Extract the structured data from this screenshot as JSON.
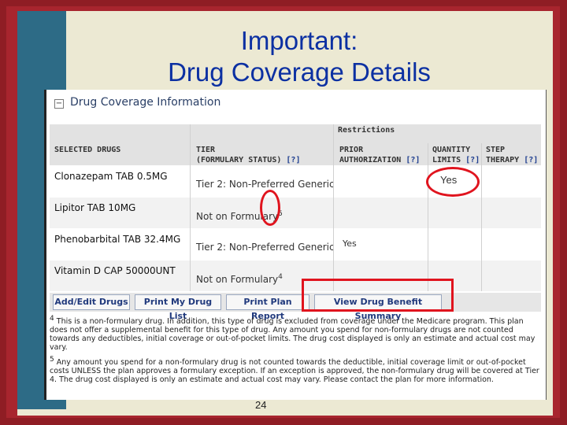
{
  "slide": {
    "title_line1": "Important:",
    "title_line2": "Drug Coverage Details",
    "page_number": "24",
    "callout_yes": "Yes",
    "accent_red": "#e0141e",
    "title_color": "#0c30a2"
  },
  "panel": {
    "collapse_symbol": "−",
    "heading": "Drug Coverage Information",
    "restrictions_label": "Restrictions",
    "columns": {
      "drugs": "SELECTED DRUGS",
      "tier_line1": "TIER",
      "tier_line2": "(FORMULARY STATUS)",
      "prior_line1": "PRIOR",
      "prior_line2": "AUTHORIZATION",
      "qty_line1": "QUANTITY",
      "qty_line2": "LIMITS",
      "step_line1": "STEP",
      "step_line2": "THERAPY",
      "help": "[?]"
    },
    "rows": [
      {
        "drug": "Clonazepam TAB 0.5MG",
        "tier": "Tier 2: Non-Preferred Generic",
        "note": "",
        "prior": ""
      },
      {
        "drug": "Lipitor TAB 10MG",
        "tier": "Not on Formulary",
        "note": "5",
        "prior": ""
      },
      {
        "drug": "Phenobarbital TAB 32.4MG",
        "tier": "Tier 2: Non-Preferred Generic",
        "note": "",
        "prior": "Yes"
      },
      {
        "drug": "Vitamin D CAP 50000UNT",
        "tier": "Not on Formulary",
        "note": "4",
        "prior": ""
      }
    ],
    "buttons": {
      "add_edit": "Add/Edit Drugs",
      "print_list": "Print My Drug List",
      "print_plan": "Print Plan Report",
      "view_summary": "View Drug Benefit Summary"
    },
    "footnotes": {
      "n4_marker": "4",
      "n4_text": "This is a non-formulary drug. In addition, this type of drug is excluded from coverage under the Medicare program. This plan does not offer a supplemental benefit for this type of drug. Any amount you spend for non-formulary drugs are not counted towards any deductibles, initial coverage or out-of-pocket limits. The drug cost displayed is only an estimate and actual cost may vary.",
      "n5_marker": "5",
      "n5_text": "Any amount you spend for a non-formulary drug is not counted towards the deductible, initial coverage limit or out-of-pocket costs UNLESS the plan approves a formulary exception. If an exception is approved, the non-formulary drug will be covered at Tier 4. The drug cost displayed is only an estimate and actual cost may vary. Please contact the plan for more information."
    }
  }
}
